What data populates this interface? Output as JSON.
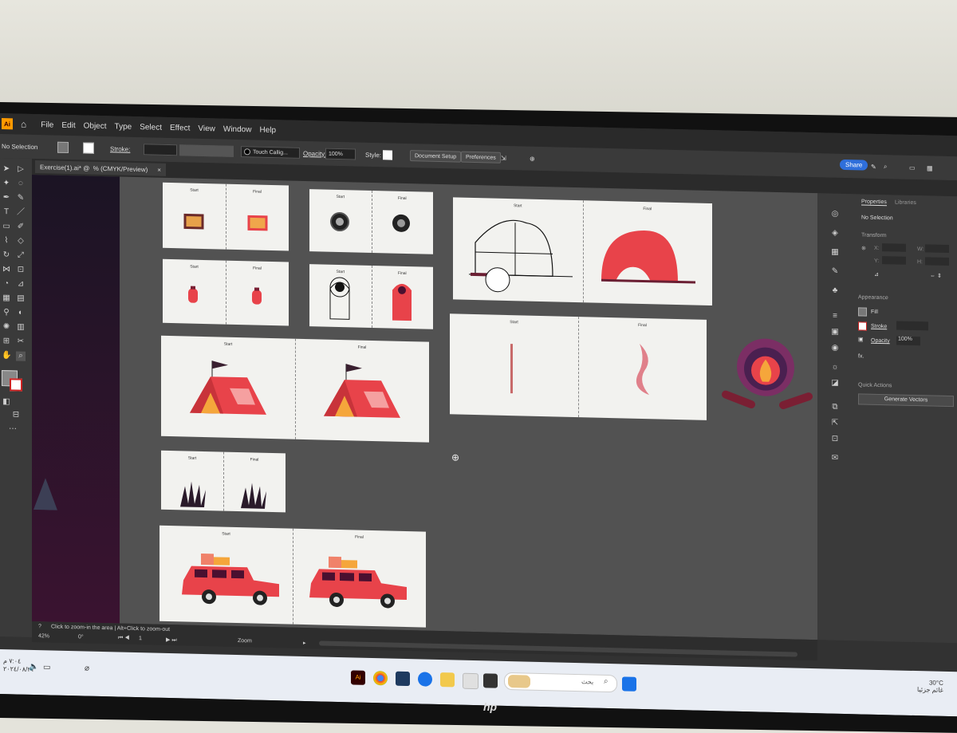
{
  "menu": {
    "app_logo": "Ai",
    "items": [
      "File",
      "Edit",
      "Object",
      "Type",
      "Select",
      "Effect",
      "View",
      "Window",
      "Help"
    ]
  },
  "control_bar": {
    "selection": "No Selection",
    "stroke_label": "Stroke:",
    "brush": "Touch Callig...",
    "opacity_label": "Opacity:",
    "opacity_value": "100%",
    "style_label": "Style:",
    "document_setup": "Document Setup",
    "preferences": "Preferences",
    "share": "Share"
  },
  "document_tab": {
    "title": "Exercise(1).ai* @  % (CMYK/Preview)",
    "close": "×"
  },
  "artboards": {
    "start_label": "Start",
    "final_label": "Final"
  },
  "properties_panel": {
    "tab_properties": "Properties",
    "tab_libraries": "Libraries",
    "no_selection": "No Selection",
    "transform": "Transform",
    "x_label": "X:",
    "y_label": "Y:",
    "w_label": "W:",
    "h_label": "H:",
    "appearance": "Appearance",
    "fill": "Fill",
    "stroke": "Stroke",
    "opacity": "Opacity",
    "opacity_value": "100%",
    "fx": "fx.",
    "quick_actions": "Quick Actions",
    "generate_vectors": "Generate Vectors"
  },
  "status_bar": {
    "hint": "Click to zoom-in the area  |  Alt+Click to zoom-out",
    "zoom_value": "42%",
    "rotation": "0°",
    "artboard_number": "1",
    "tool_name": "Zoom"
  },
  "taskbar": {
    "search_placeholder": "بحث",
    "weather": "30°C",
    "weather_desc": "غائم جزئيا",
    "time": "٧:٠٤ م",
    "date": "٢٠٢٤/٠٨/٢١"
  },
  "monitor_brand": "hp",
  "colors": {
    "accent_red": "#e8434a",
    "dark_red": "#7a1f33",
    "share_blue": "#2f6fdb",
    "orange": "#f5a63b"
  }
}
